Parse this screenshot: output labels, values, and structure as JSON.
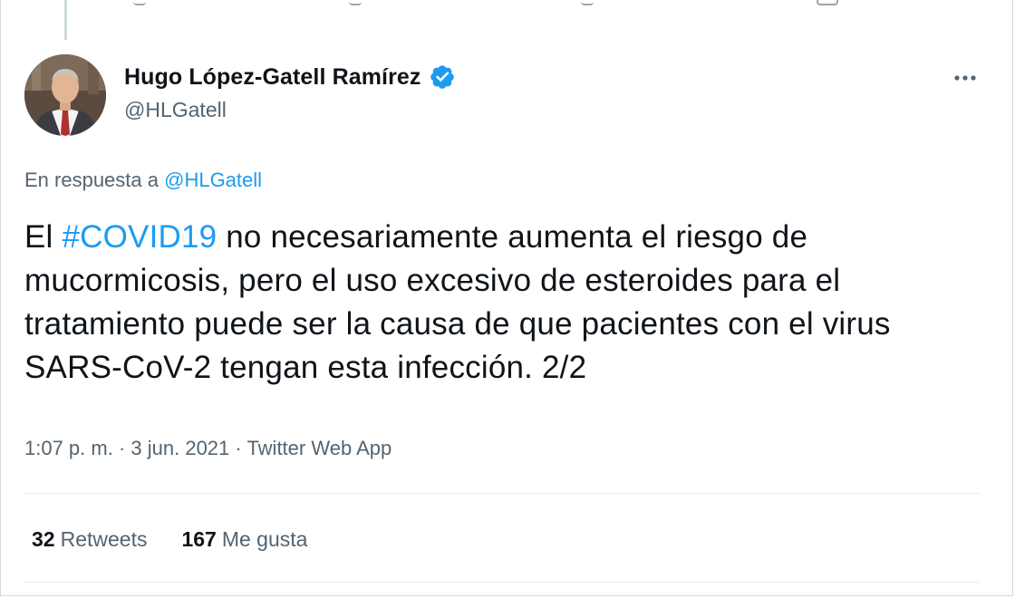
{
  "tweet": {
    "author": {
      "display_name": "Hugo López-Gatell Ramírez",
      "handle": "@HLGatell",
      "verified": true
    },
    "reply_to": {
      "prefix": "En respuesta a",
      "mention": "@HLGatell"
    },
    "text": {
      "part1": "El ",
      "hashtag": "#COVID19",
      "part2": " no necesariamente aumenta el riesgo de mucormicosis, pero el uso excesivo de esteroides para el tratamiento puede ser la causa de que pacientes con el virus SARS-CoV-2 tengan esta infección. 2/2"
    },
    "meta": {
      "time": "1:07 p. m.",
      "separator": " · ",
      "date": "3 jun. 2021",
      "source": "Twitter Web App"
    },
    "stats": {
      "retweets_count": "32",
      "retweets_label": "Retweets",
      "likes_count": "167",
      "likes_label": "Me gusta"
    },
    "icons": {
      "verified": "verified-badge-icon",
      "more": "more-horizontal-icon"
    },
    "colors": {
      "link": "#1d9bf0",
      "secondary_text": "#536471",
      "primary_text": "#0f1419"
    }
  }
}
